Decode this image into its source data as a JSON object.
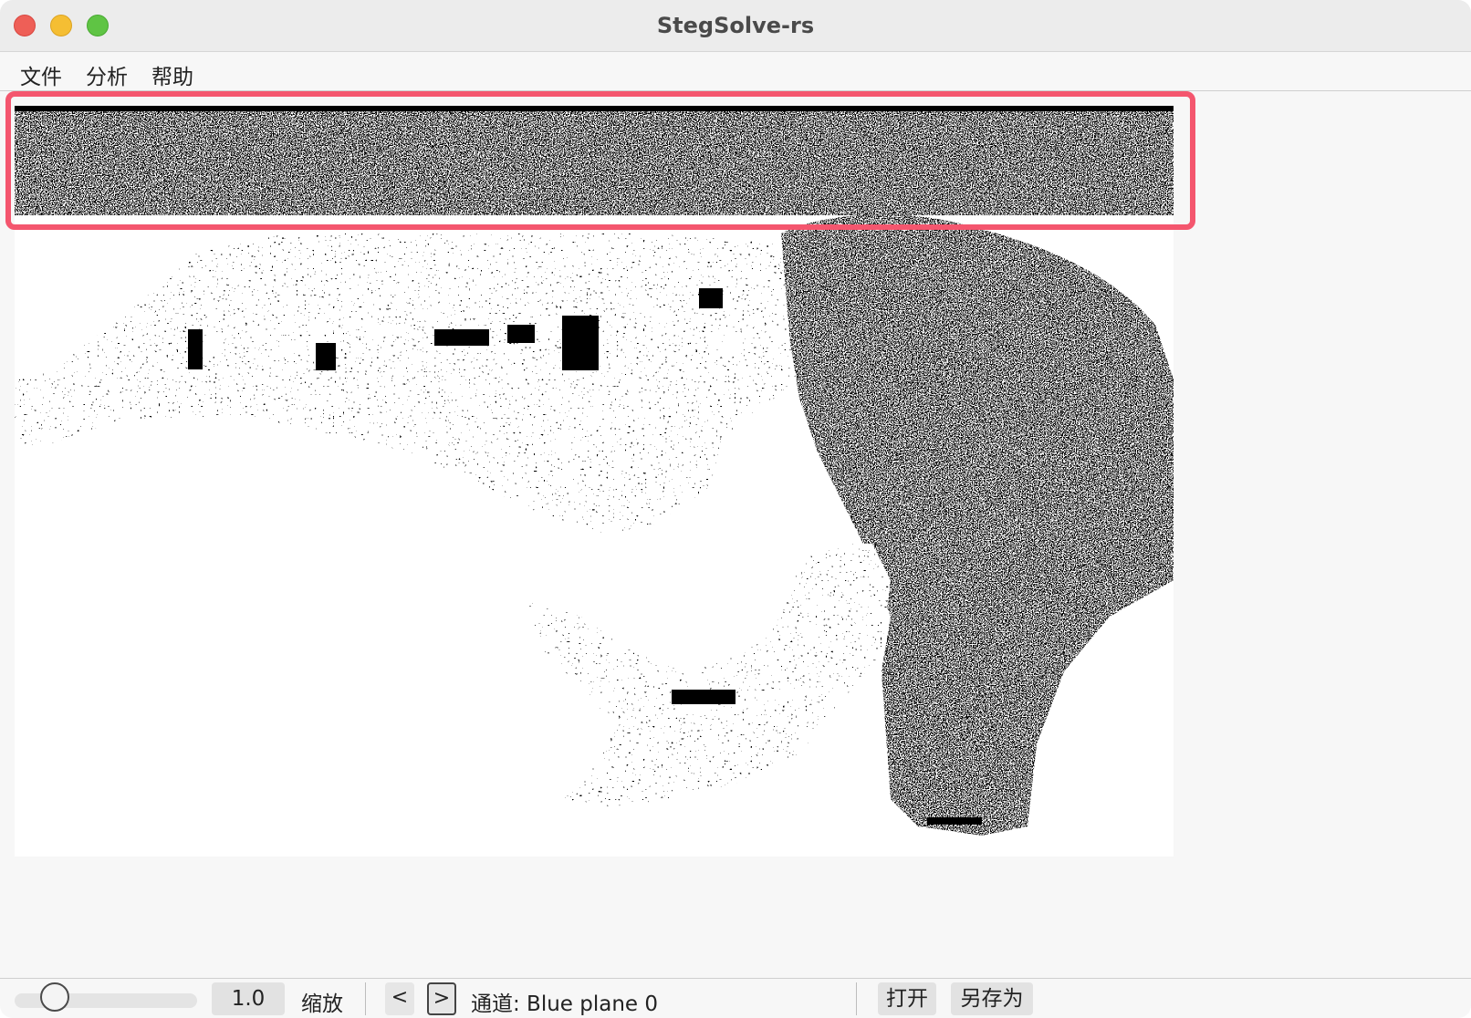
{
  "window": {
    "title": "StegSolve-rs"
  },
  "menu": {
    "items": [
      "文件",
      "分析",
      "帮助"
    ]
  },
  "toolbar": {
    "zoom_value": "1.0",
    "zoom_label": "缩放",
    "prev_label": "<",
    "next_label": ">",
    "channel_text": "通道: Blue plane 0",
    "open_label": "打开",
    "save_as_label": "另存为",
    "zoom_slider_fraction": 0.22
  },
  "colors": {
    "highlight": "#f4566e",
    "close": "#ee5f57",
    "minimize": "#f5be33",
    "maximize": "#5fc444"
  }
}
